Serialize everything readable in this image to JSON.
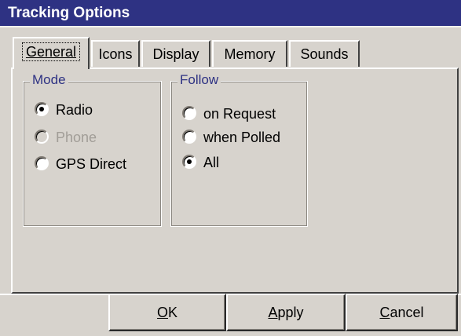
{
  "window": {
    "title": "Tracking Options"
  },
  "tabs": [
    {
      "label": "General",
      "active": true
    },
    {
      "label": "Icons",
      "active": false
    },
    {
      "label": "Display",
      "active": false
    },
    {
      "label": "Memory",
      "active": false
    },
    {
      "label": "Sounds",
      "active": false
    }
  ],
  "mode_group": {
    "title": "Mode",
    "options": [
      {
        "label": "Radio",
        "selected": true,
        "enabled": true
      },
      {
        "label": "Phone",
        "selected": false,
        "enabled": false
      },
      {
        "label": "GPS Direct",
        "selected": false,
        "enabled": true
      }
    ]
  },
  "follow_group": {
    "title": "Follow",
    "options": [
      {
        "label": "on Request",
        "selected": false,
        "enabled": true
      },
      {
        "label": "when Polled",
        "selected": false,
        "enabled": true
      },
      {
        "label": "All",
        "selected": true,
        "enabled": true
      }
    ]
  },
  "buttons": {
    "ok": {
      "mnemonic": "O",
      "rest": "K"
    },
    "apply": {
      "mnemonic": "A",
      "rest": "pply"
    },
    "cancel": {
      "mnemonic": "C",
      "rest": "ancel"
    }
  },
  "colors": {
    "titlebar": "#2e3283",
    "face": "#d7d3cd",
    "group_title": "#2e3283",
    "disabled_text": "#a19d97"
  }
}
